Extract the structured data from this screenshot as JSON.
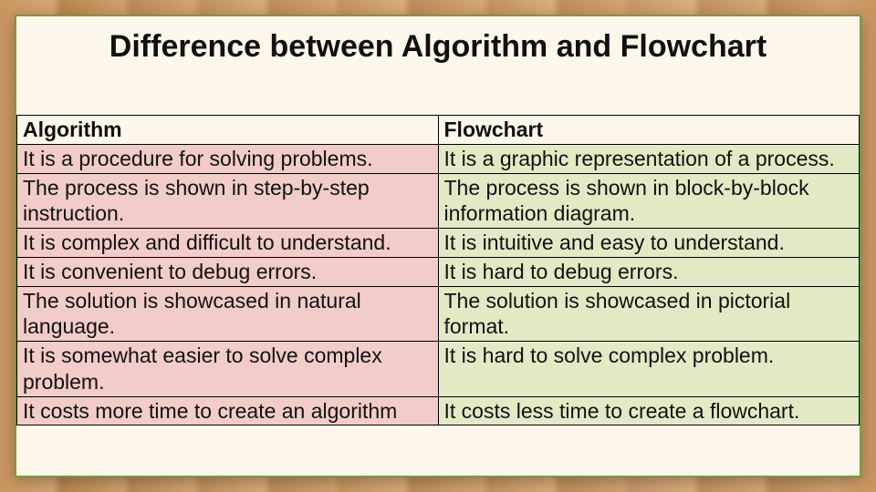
{
  "title": "Difference between Algorithm and Flowchart",
  "headers": {
    "left": "Algorithm",
    "right": "Flowchart"
  },
  "rows": [
    {
      "left": "It is a procedure for solving problems.",
      "right": "It is a graphic representation of a process."
    },
    {
      "left": "The process is shown in step-by-step instruction.",
      "right": "The process is shown in block-by-block information diagram."
    },
    {
      "left": "It is complex and difficult to understand.",
      "right": "It is intuitive and easy to understand."
    },
    {
      "left": "It is convenient to debug errors.",
      "right": "It is hard to debug errors."
    },
    {
      "left": "The solution is showcased in natural language.",
      "right": "The solution is showcased in pictorial format."
    },
    {
      "left": "It is somewhat easier to solve complex problem.",
      "right": "It is hard to solve complex problem."
    },
    {
      "left": "It costs more time to create an algorithm",
      "right": "It costs less time to create a flowchart."
    }
  ]
}
